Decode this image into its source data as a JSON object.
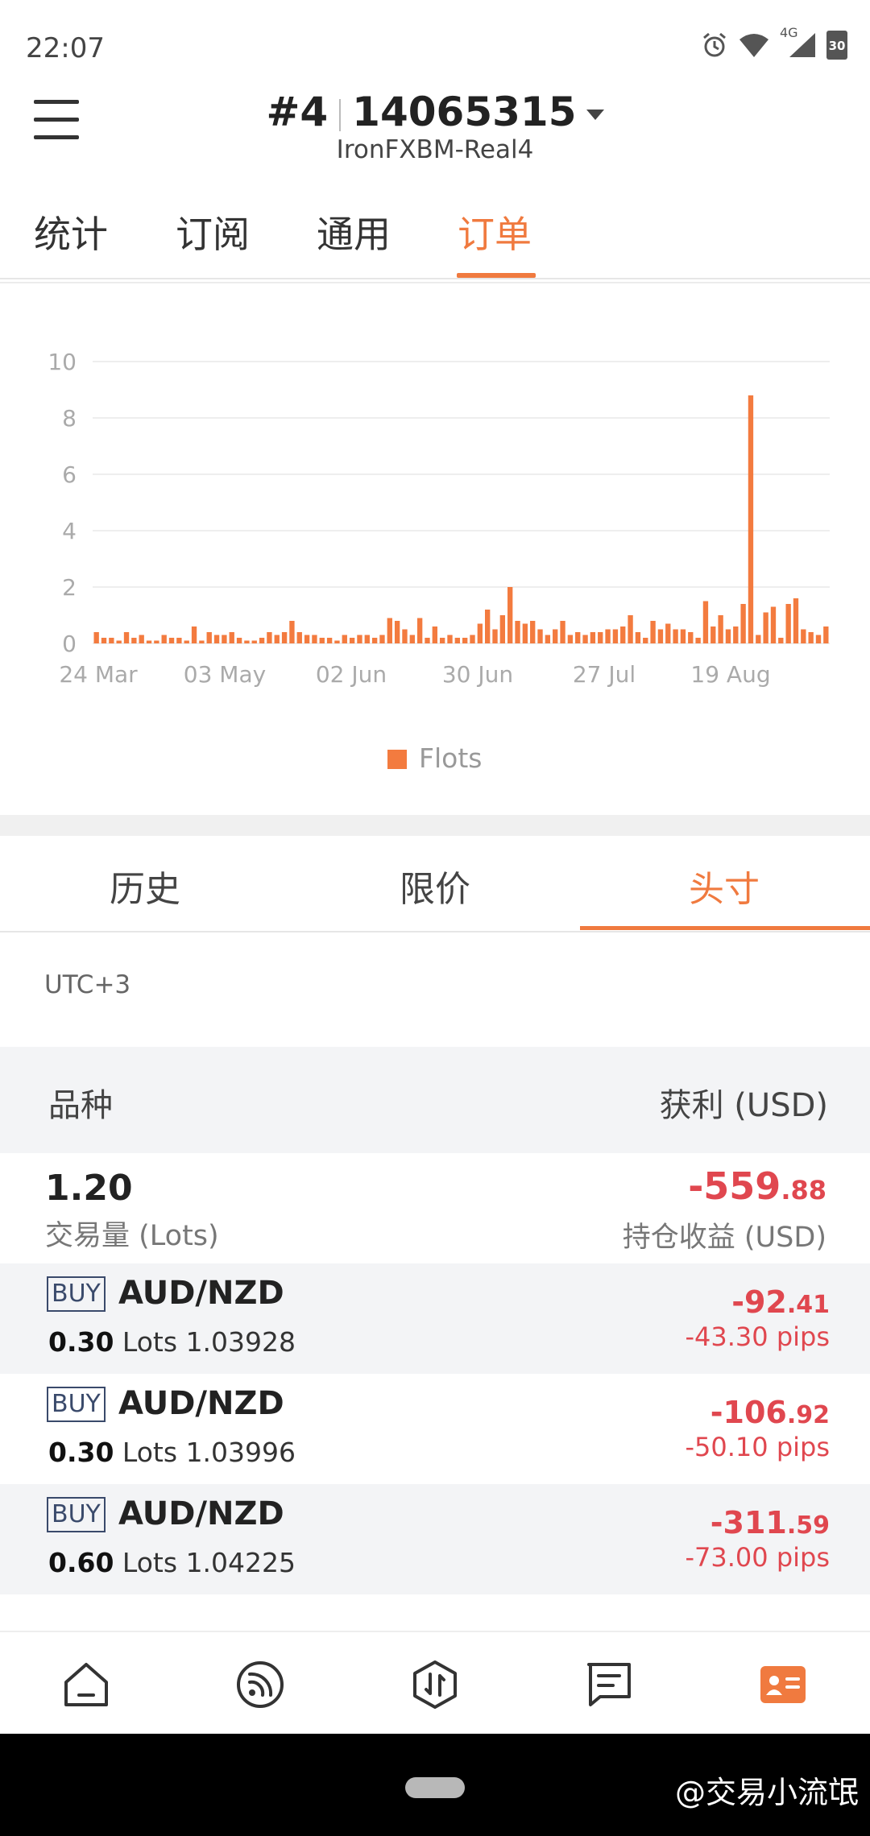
{
  "status": {
    "time": "22:07",
    "network": "4G",
    "battery": "30"
  },
  "header": {
    "account_no": "#4",
    "account_id": "14065315",
    "server": "IronFXBM-Real4"
  },
  "top_tabs": [
    "统计",
    "订阅",
    "通用",
    "订单"
  ],
  "chart_data": {
    "type": "bar",
    "ylim": [
      0,
      10
    ],
    "y_ticks": [
      "0",
      "2",
      "4",
      "6",
      "8",
      "10"
    ],
    "x_tick_labels": [
      "24 Mar",
      "03 May",
      "02 Jun",
      "30 Jun",
      "27 Jul",
      "19 Aug"
    ],
    "values": [
      0.4,
      0.2,
      0.2,
      0.1,
      0.4,
      0.2,
      0.3,
      0.1,
      0.1,
      0.3,
      0.2,
      0.2,
      0.1,
      0.6,
      0.1,
      0.4,
      0.3,
      0.3,
      0.4,
      0.2,
      0.1,
      0.1,
      0.2,
      0.4,
      0.3,
      0.4,
      0.8,
      0.4,
      0.3,
      0.3,
      0.2,
      0.2,
      0.1,
      0.3,
      0.2,
      0.3,
      0.3,
      0.2,
      0.3,
      0.9,
      0.8,
      0.5,
      0.3,
      0.9,
      0.2,
      0.6,
      0.2,
      0.3,
      0.2,
      0.2,
      0.3,
      0.7,
      1.2,
      0.5,
      1.0,
      2.0,
      0.8,
      0.7,
      0.8,
      0.5,
      0.3,
      0.5,
      0.8,
      0.3,
      0.4,
      0.3,
      0.4,
      0.4,
      0.5,
      0.5,
      0.6,
      1.0,
      0.4,
      0.2,
      0.8,
      0.5,
      0.7,
      0.5,
      0.5,
      0.4,
      0.2,
      1.5,
      0.6,
      1.0,
      0.5,
      0.6,
      1.4,
      8.8,
      0.3,
      1.1,
      1.3,
      0.2,
      1.4,
      1.6,
      0.5,
      0.4,
      0.3,
      0.6
    ],
    "legend": [
      {
        "name": "Flots",
        "color": "#f37b3f"
      }
    ],
    "legend_position": "bottom",
    "grid": true
  },
  "sub_tabs": [
    "历史",
    "限价",
    "头寸"
  ],
  "timezone": "UTC+3",
  "table": {
    "col_symbol": "品种",
    "col_profit": "获利 (USD)"
  },
  "summary": {
    "lots": "1.20",
    "lots_label": "交易量 (Lots)",
    "profit_main": "-559",
    "profit_frac": ".88",
    "profit_label": "持仓收益 (USD)"
  },
  "positions": [
    {
      "side": "BUY",
      "symbol": "AUD/NZD",
      "lots": "0.30",
      "lots_unit": "Lots",
      "price": "1.03928",
      "profit_main": "-92",
      "profit_frac": ".41",
      "pips": "-43.30 pips"
    },
    {
      "side": "BUY",
      "symbol": "AUD/NZD",
      "lots": "0.30",
      "lots_unit": "Lots",
      "price": "1.03996",
      "profit_main": "-106",
      "profit_frac": ".92",
      "pips": "-50.10 pips"
    },
    {
      "side": "BUY",
      "symbol": "AUD/NZD",
      "lots": "0.60",
      "lots_unit": "Lots",
      "price": "1.04225",
      "profit_main": "-311",
      "profit_frac": ".59",
      "pips": "-73.00 pips"
    }
  ],
  "bottom_nav": [
    "home-icon",
    "feed-icon",
    "trade-icon",
    "messages-icon",
    "account-icon"
  ],
  "watermark": "@交易小流氓",
  "colors": {
    "accent": "#f07a3f",
    "bar": "#f37b3f",
    "loss": "#e0474f",
    "badge": "#3a4a6b"
  }
}
